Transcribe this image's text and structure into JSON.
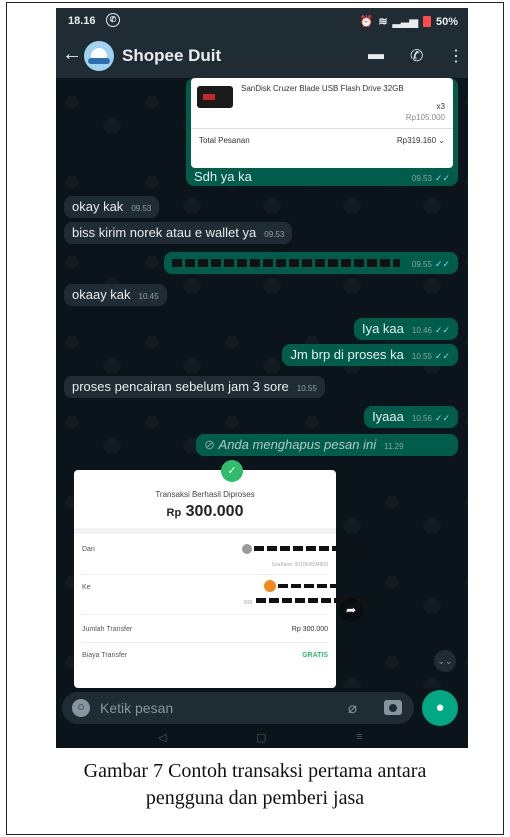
{
  "status_bar": {
    "time": "18.16",
    "battery": "50%"
  },
  "header": {
    "back_icon": "arrow-left-icon",
    "title": "Shopee Duit"
  },
  "order_card": {
    "product_name": "SanDisk Cruzer Blade USB Flash Drive 32GB",
    "quantity": "x3",
    "unit_price": "Rp105.000",
    "total_label": "Total Pesanan",
    "total_value": "Rp319.160"
  },
  "messages": [
    {
      "direction": "out",
      "text": "Sdh ya ka",
      "time": "09.53",
      "read": true
    },
    {
      "direction": "in",
      "text": "okay kak",
      "time": "09.53"
    },
    {
      "direction": "in",
      "text": "biss kirim norek atau e wallet ya",
      "time": "09.53"
    },
    {
      "direction": "out",
      "text": "",
      "time": "09.55",
      "read": true,
      "redacted": true
    },
    {
      "direction": "in",
      "text": "okaay kak",
      "time": "10.45"
    },
    {
      "direction": "out",
      "text": "Iya kaa",
      "time": "10.46",
      "read": true
    },
    {
      "direction": "out",
      "text": "Jm brp di proses ka",
      "time": "10.55",
      "read": true
    },
    {
      "direction": "in",
      "text": "proses pencairan sebelum jam 3 sore",
      "time": "10.55"
    },
    {
      "direction": "out",
      "text": "Iyaaa",
      "time": "10.56",
      "read": true
    },
    {
      "direction": "out",
      "text": "Anda menghapus pesan ini",
      "time": "11.29",
      "deleted": true
    }
  ],
  "receipt": {
    "status": "Transaksi Berhasil Diproses",
    "currency": "Rp",
    "amount": "300.000",
    "from_label": "Dari",
    "from_sub": "SeaBank: 901864594809",
    "to_label": "Ke",
    "to_sub": "BRI",
    "transfer_amount_label": "Jumlah Transfer",
    "transfer_amount_value": "Rp 300.000",
    "fee_label": "Biaya Transfer",
    "fee_value": "GRATIS"
  },
  "composer": {
    "placeholder": "Ketik pesan"
  },
  "caption": {
    "line1": "Gambar 7 Contoh transaksi pertama antara",
    "line2": "pengguna dan pemberi jasa"
  },
  "colors": {
    "outgoing": "#005c4b",
    "incoming": "#202c33",
    "accent": "#00a884",
    "background": "#0b141a"
  }
}
